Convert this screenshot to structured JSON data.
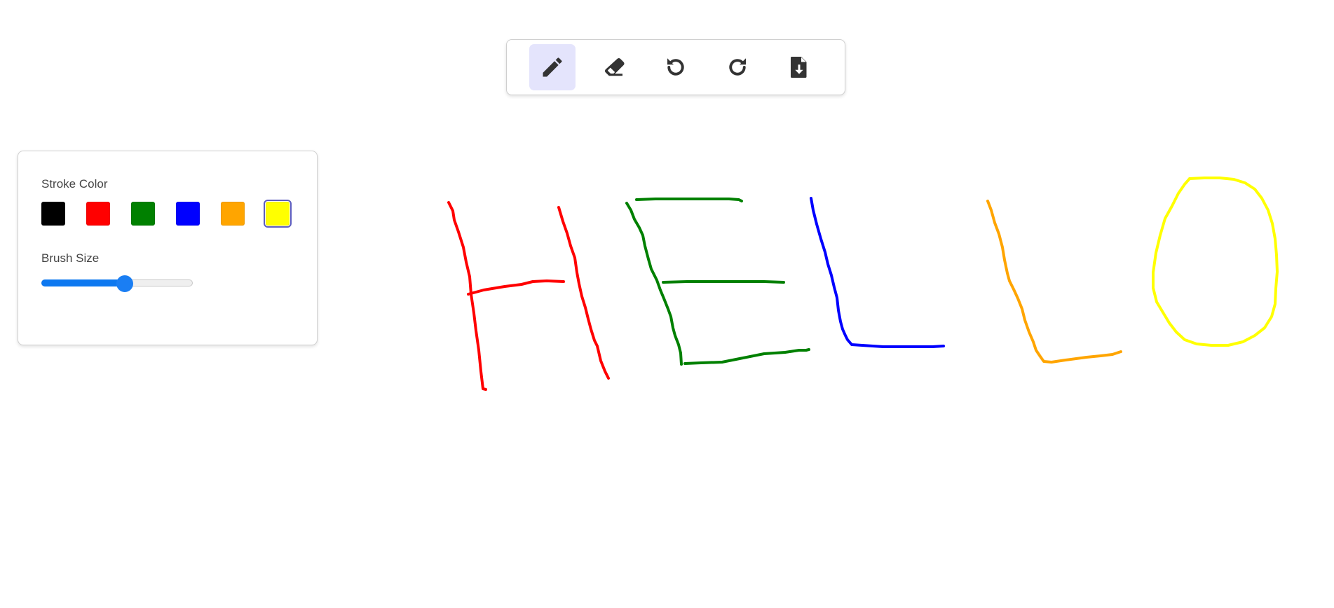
{
  "toolbar": {
    "tools": [
      {
        "id": "pencil",
        "icon": "pencil-icon",
        "active": true
      },
      {
        "id": "eraser",
        "icon": "eraser-icon",
        "active": false
      },
      {
        "id": "undo",
        "icon": "undo-icon",
        "active": false
      },
      {
        "id": "redo",
        "icon": "redo-icon",
        "active": false
      },
      {
        "id": "download",
        "icon": "file-download-icon",
        "active": false
      }
    ],
    "active_color": "#e4e4fc",
    "icon_color": "#333333"
  },
  "panel": {
    "stroke_color_label": "Stroke Color",
    "brush_size_label": "Brush Size",
    "colors": [
      "#000000",
      "#ff0000",
      "#008000",
      "#0000ff",
      "#ffa500",
      "#ffff00"
    ],
    "selected_color": "#ffff00",
    "brush_size_fraction": 0.55
  },
  "canvas": {
    "strokes_text": "HELLO",
    "stroke_colors": [
      "#ff0000",
      "#008000",
      "#0000ff",
      "#ffa500",
      "#ffff00"
    ]
  }
}
